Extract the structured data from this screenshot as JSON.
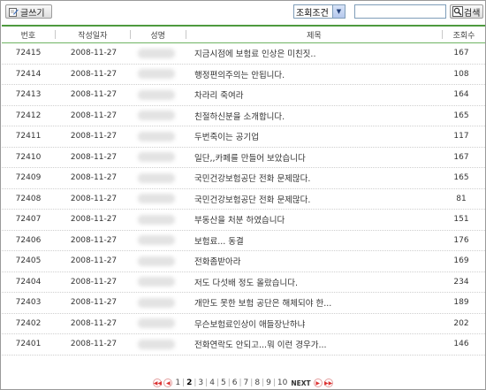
{
  "toolbar": {
    "write_label": "글쓰기",
    "search_condition": "조회조건",
    "search_value": "",
    "search_label": "검색"
  },
  "table": {
    "headers": [
      "번호",
      "작성일자",
      "성명",
      "제목",
      "조회수"
    ],
    "rows": [
      {
        "num": "72415",
        "date": "2008-11-27",
        "title": "지금시점에 보험료 인상은 미친짓..",
        "views": "167"
      },
      {
        "num": "72414",
        "date": "2008-11-27",
        "title": "행정편의주의는 안됩니다.",
        "views": "108"
      },
      {
        "num": "72413",
        "date": "2008-11-27",
        "title": "차라리 죽여라",
        "views": "164"
      },
      {
        "num": "72412",
        "date": "2008-11-27",
        "title": "친절하신분을 소개합니다.",
        "views": "165"
      },
      {
        "num": "72411",
        "date": "2008-11-27",
        "title": "두번죽이는 공기업",
        "views": "117"
      },
      {
        "num": "72410",
        "date": "2008-11-27",
        "title": "일단,,카페를 만들어 보았습니다",
        "views": "167"
      },
      {
        "num": "72409",
        "date": "2008-11-27",
        "title": "국민건강보험공단 전화 문제많다.",
        "views": "165"
      },
      {
        "num": "72408",
        "date": "2008-11-27",
        "title": "국민건강보험공단 전화 문제많다.",
        "views": "81"
      },
      {
        "num": "72407",
        "date": "2008-11-27",
        "title": "부동산을 처분 하였습니다",
        "views": "151"
      },
      {
        "num": "72406",
        "date": "2008-11-27",
        "title": "보험료... 동결",
        "views": "176"
      },
      {
        "num": "72405",
        "date": "2008-11-27",
        "title": "전화좀받아라",
        "views": "169"
      },
      {
        "num": "72404",
        "date": "2008-11-27",
        "title": "저도 다섯배 정도 올랐습니다.",
        "views": "234"
      },
      {
        "num": "72403",
        "date": "2008-11-27",
        "title": "개만도 못한 보험 공단은 해체되야 한...",
        "views": "189"
      },
      {
        "num": "72402",
        "date": "2008-11-27",
        "title": "무슨보험료인상이 애들장난하냐",
        "views": "202"
      },
      {
        "num": "72401",
        "date": "2008-11-27",
        "title": "전화연락도 안되고...뭐 이런 경우가...",
        "views": "146"
      }
    ]
  },
  "pager": {
    "pages": [
      "1",
      "2",
      "3",
      "4",
      "5",
      "6",
      "7",
      "8",
      "9",
      "10"
    ],
    "current": "2",
    "next_label": "NEXT"
  },
  "colors": {
    "header_line": "#4e9a3e",
    "nav_button": "#d33333"
  }
}
